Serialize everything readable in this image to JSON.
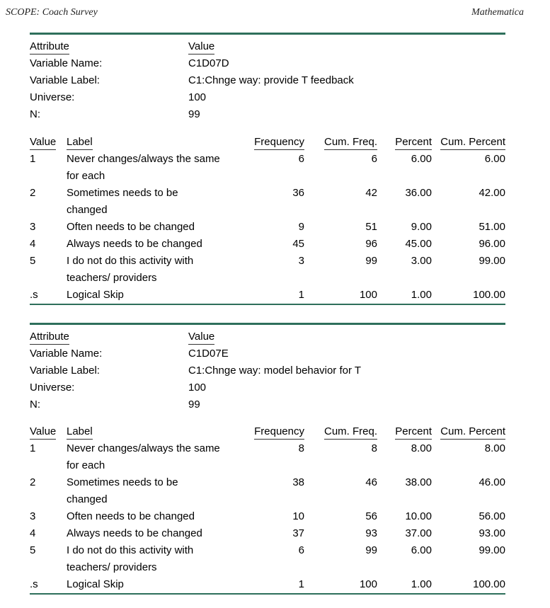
{
  "header": {
    "left": "SCOPE: Coach Survey",
    "right": "Mathematica"
  },
  "colors": {
    "rule": "#2e6f5b"
  },
  "tables": [
    {
      "attributes_header": {
        "attribute": "Attribute",
        "value": "Value"
      },
      "attributes": [
        {
          "label": "Variable Name:",
          "value": "C1D07D"
        },
        {
          "label": "Variable Label:",
          "value": "C1:Chnge way: provide T feedback"
        },
        {
          "label": "Universe:",
          "value": "100"
        },
        {
          "label": "N:",
          "value": "99"
        }
      ],
      "freq_header": {
        "value": "Value",
        "label": "Label",
        "frequency": "Frequency",
        "cum_freq": "Cum. Freq.",
        "percent": "Percent",
        "cum_percent": "Cum. Percent"
      },
      "rows": [
        {
          "value": "1",
          "label": "Never changes/always the same",
          "label2": "for each",
          "frequency": "6",
          "cum_freq": "6",
          "percent": "6.00",
          "cum_percent": "6.00"
        },
        {
          "value": "2",
          "label": "Sometimes needs to be",
          "label2": "changed",
          "frequency": "36",
          "cum_freq": "42",
          "percent": "36.00",
          "cum_percent": "42.00"
        },
        {
          "value": "3",
          "label": "Often needs to be changed",
          "label2": "",
          "frequency": "9",
          "cum_freq": "51",
          "percent": "9.00",
          "cum_percent": "51.00"
        },
        {
          "value": "4",
          "label": "Always needs to be changed",
          "label2": "",
          "frequency": "45",
          "cum_freq": "96",
          "percent": "45.00",
          "cum_percent": "96.00"
        },
        {
          "value": "5",
          "label": "I do not do this activity with",
          "label2": "teachers/ providers",
          "frequency": "3",
          "cum_freq": "99",
          "percent": "3.00",
          "cum_percent": "99.00"
        },
        {
          "value": ".s",
          "label": "Logical Skip",
          "label2": "",
          "frequency": "1",
          "cum_freq": "100",
          "percent": "1.00",
          "cum_percent": "100.00"
        }
      ]
    },
    {
      "attributes_header": {
        "attribute": "Attribute",
        "value": "Value"
      },
      "attributes": [
        {
          "label": "Variable Name:",
          "value": "C1D07E"
        },
        {
          "label": "Variable Label:",
          "value": "C1:Chnge way: model behavior for T"
        },
        {
          "label": "Universe:",
          "value": "100"
        },
        {
          "label": "N:",
          "value": "99"
        }
      ],
      "freq_header": {
        "value": "Value",
        "label": "Label",
        "frequency": "Frequency",
        "cum_freq": "Cum. Freq.",
        "percent": "Percent",
        "cum_percent": "Cum. Percent"
      },
      "rows": [
        {
          "value": "1",
          "label": "Never changes/always the same",
          "label2": "for each",
          "frequency": "8",
          "cum_freq": "8",
          "percent": "8.00",
          "cum_percent": "8.00"
        },
        {
          "value": "2",
          "label": "Sometimes needs to be",
          "label2": "changed",
          "frequency": "38",
          "cum_freq": "46",
          "percent": "38.00",
          "cum_percent": "46.00"
        },
        {
          "value": "3",
          "label": "Often needs to be changed",
          "label2": "",
          "frequency": "10",
          "cum_freq": "56",
          "percent": "10.00",
          "cum_percent": "56.00"
        },
        {
          "value": "4",
          "label": "Always needs to be changed",
          "label2": "",
          "frequency": "37",
          "cum_freq": "93",
          "percent": "37.00",
          "cum_percent": "93.00"
        },
        {
          "value": "5",
          "label": "I do not do this activity with",
          "label2": "teachers/ providers",
          "frequency": "6",
          "cum_freq": "99",
          "percent": "6.00",
          "cum_percent": "99.00"
        },
        {
          "value": ".s",
          "label": "Logical Skip",
          "label2": "",
          "frequency": "1",
          "cum_freq": "100",
          "percent": "1.00",
          "cum_percent": "100.00"
        }
      ]
    }
  ]
}
